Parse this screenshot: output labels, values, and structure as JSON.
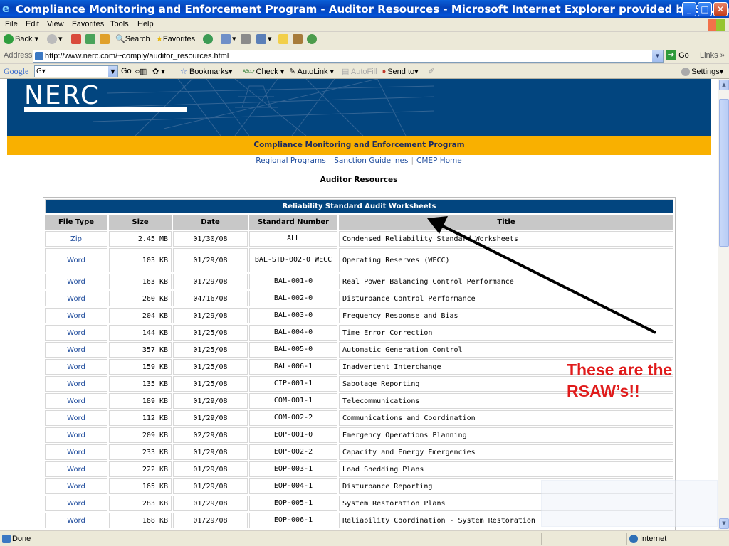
{
  "window": {
    "title": "Compliance Monitoring and Enforcement Program - Auditor Resources - Microsoft Internet Explorer provided by Southern Comp...",
    "controls": {
      "minimize": "_",
      "maximize": "□",
      "close": "✕"
    }
  },
  "menubar": {
    "items": [
      "File",
      "Edit",
      "View",
      "Favorites",
      "Tools",
      "Help"
    ]
  },
  "toolbar": {
    "back": "Back",
    "search": "Search",
    "favorites": "Favorites"
  },
  "addressbar": {
    "label": "Address",
    "url": "http://www.nerc.com/~comply/auditor_resources.html",
    "go": "Go",
    "links": "Links"
  },
  "googlebar": {
    "logo": "Google",
    "search_value": "G▾",
    "go": "Go",
    "bookmarks": "Bookmarks▾",
    "check": "Check ▾",
    "autolink": "AutoLink ▾",
    "autofill": "AutoFill",
    "send_to": "Send to▾",
    "settings": "Settings▾"
  },
  "page": {
    "program_title": "Compliance Monitoring and Enforcement Program",
    "subnav": [
      "Regional Programs",
      "Sanction Guidelines",
      "CMEP Home"
    ],
    "heading": "Auditor Resources",
    "table": {
      "title": "Reliability Standard Audit Worksheets",
      "headers": [
        "File Type",
        "Size",
        "Date",
        "Standard Number",
        "Title"
      ],
      "rows": [
        {
          "type": "Zip",
          "size": "2.45 MB",
          "date": "01/30/08",
          "number": "ALL",
          "title": "Condensed Reliability Standard Worksheets"
        },
        {
          "type": "Word",
          "size": "103 KB",
          "date": "01/29/08",
          "number": "BAL-STD-002-0 WECC",
          "title": "Operating Reserves (WECC)"
        },
        {
          "type": "Word",
          "size": "163 KB",
          "date": "01/29/08",
          "number": "BAL-001-0",
          "title": "Real Power Balancing Control Performance"
        },
        {
          "type": "Word",
          "size": "260 KB",
          "date": "04/16/08",
          "number": "BAL-002-0",
          "title": "Disturbance Control Performance"
        },
        {
          "type": "Word",
          "size": "204 KB",
          "date": "01/29/08",
          "number": "BAL-003-0",
          "title": "Frequency Response and Bias"
        },
        {
          "type": "Word",
          "size": "144 KB",
          "date": "01/25/08",
          "number": "BAL-004-0",
          "title": "Time Error Correction"
        },
        {
          "type": "Word",
          "size": "357 KB",
          "date": "01/25/08",
          "number": "BAL-005-0",
          "title": "Automatic Generation Control"
        },
        {
          "type": "Word",
          "size": "159 KB",
          "date": "01/25/08",
          "number": "BAL-006-1",
          "title": "Inadvertent Interchange"
        },
        {
          "type": "Word",
          "size": "135 KB",
          "date": "01/25/08",
          "number": "CIP-001-1",
          "title": "Sabotage Reporting"
        },
        {
          "type": "Word",
          "size": "189 KB",
          "date": "01/29/08",
          "number": "COM-001-1",
          "title": "Telecommunications"
        },
        {
          "type": "Word",
          "size": "112 KB",
          "date": "01/29/08",
          "number": "COM-002-2",
          "title": "Communications and Coordination"
        },
        {
          "type": "Word",
          "size": "209 KB",
          "date": "02/29/08",
          "number": "EOP-001-0",
          "title": "Emergency Operations Planning"
        },
        {
          "type": "Word",
          "size": "233 KB",
          "date": "01/29/08",
          "number": "EOP-002-2",
          "title": "Capacity and Energy Emergencies"
        },
        {
          "type": "Word",
          "size": "222 KB",
          "date": "01/29/08",
          "number": "EOP-003-1",
          "title": "Load Shedding Plans"
        },
        {
          "type": "Word",
          "size": "165 KB",
          "date": "01/29/08",
          "number": "EOP-004-1",
          "title": "Disturbance Reporting"
        },
        {
          "type": "Word",
          "size": "283 KB",
          "date": "01/29/08",
          "number": "EOP-005-1",
          "title": "System Restoration Plans"
        },
        {
          "type": "Word",
          "size": "168 KB",
          "date": "01/29/08",
          "number": "EOP-006-1",
          "title": "Reliability Coordination - System Restoration"
        }
      ]
    }
  },
  "callout": {
    "text_line1": "These are the",
    "text_line2": "RSAW’s!!",
    "color": "#e01b1b"
  },
  "statusbar": {
    "status": "Done",
    "zone": "Internet"
  },
  "colors": {
    "titlebar": "#0442b8",
    "nerc_blue": "#02457f",
    "cmep_gold": "#f9b000",
    "link": "#1f4c9c"
  }
}
